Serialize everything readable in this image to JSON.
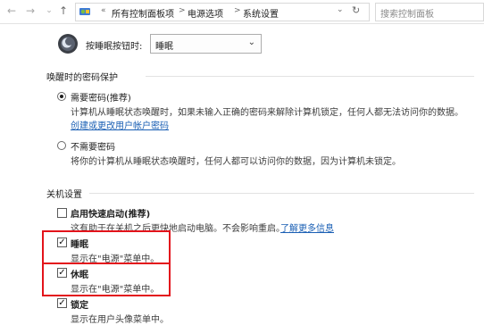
{
  "address_bar": {
    "breadcrumbs": [
      "所有控制面板项",
      "电源选项",
      "系统设置"
    ],
    "overflow": "«",
    "separator": ">",
    "search_placeholder": "搜索控制面板"
  },
  "sleep_button": {
    "label": "按睡眠按钮时:",
    "value": "睡眠"
  },
  "password_section": {
    "title": "唤醒时的密码保护",
    "require": {
      "label": "需要密码(推荐)",
      "desc": "计算机从睡眠状态唤醒时，如果未输入正确的密码来解除计算机锁定，任何人都无法访问你的数据。",
      "link": "创建或更改用户帐户密码",
      "selected": true
    },
    "no_password": {
      "label": "不需要密码",
      "desc": "将你的计算机从睡眠状态唤醒时，任何人都可以访问你的数据，因为计算机未锁定。",
      "selected": false
    }
  },
  "shutdown_section": {
    "title": "关机设置",
    "fast_startup": {
      "label": "启用快速启动(推荐)",
      "desc": "这有助于在关机之后更快地启动电脑。不会影响重启。",
      "link": "了解更多信息",
      "checked": false
    },
    "sleep": {
      "label": "睡眠",
      "desc": "显示在\"电源\"菜单中。",
      "checked": true
    },
    "hibernate": {
      "label": "休眠",
      "desc": "显示在\"电源\"菜单中。",
      "checked": true
    },
    "lock": {
      "label": "锁定",
      "desc": "显示在用户头像菜单中。",
      "checked": true
    }
  },
  "colors": {
    "highlight": "#e3131b",
    "link": "#1a5fb4"
  }
}
